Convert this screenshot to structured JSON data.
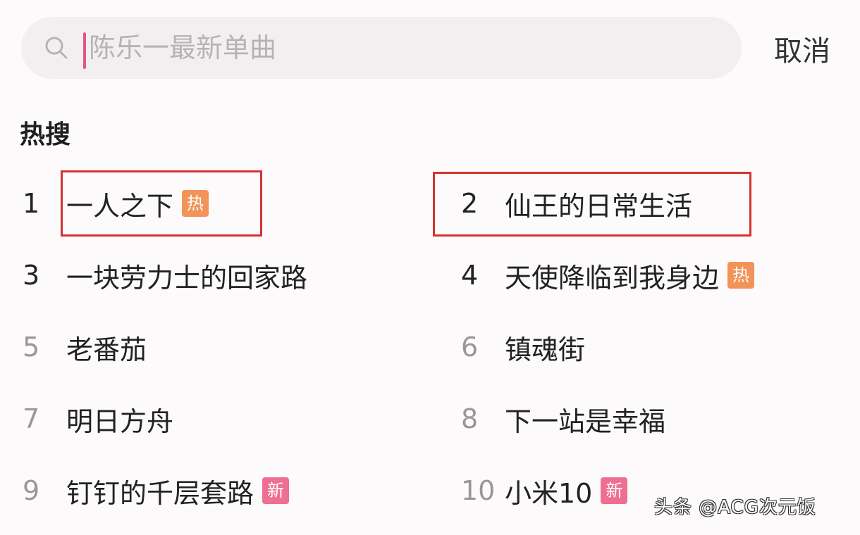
{
  "search": {
    "placeholder": "陈乐一最新单曲",
    "cancel_label": "取消"
  },
  "hot": {
    "title": "热搜",
    "items": [
      {
        "rank": "1",
        "label": "一人之下",
        "badge": "热"
      },
      {
        "rank": "2",
        "label": "仙王的日常生活",
        "badge": ""
      },
      {
        "rank": "3",
        "label": "一块劳力士的回家路",
        "badge": ""
      },
      {
        "rank": "4",
        "label": "天使降临到我身边",
        "badge": "热"
      },
      {
        "rank": "5",
        "label": "老番茄",
        "badge": ""
      },
      {
        "rank": "6",
        "label": "镇魂街",
        "badge": ""
      },
      {
        "rank": "7",
        "label": "明日方舟",
        "badge": ""
      },
      {
        "rank": "8",
        "label": "下一站是幸福",
        "badge": ""
      },
      {
        "rank": "9",
        "label": "钉钉的千层套路",
        "badge": "新"
      },
      {
        "rank": "10",
        "label": "小米10",
        "badge": "新"
      }
    ]
  },
  "watermark": "头条 @ACG次元饭",
  "colors": {
    "accent_caret": "#e2577e",
    "badge_hot": "#f29359",
    "badge_new": "#ee6f91",
    "highlight_box": "#d6312f"
  }
}
